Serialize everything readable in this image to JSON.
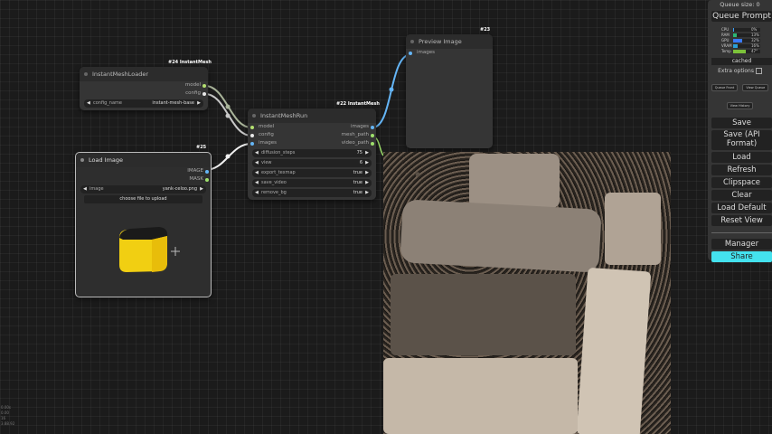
{
  "queue": {
    "size_text": "Queue size: 0",
    "prompt_label": "Queue Prompt"
  },
  "monitor": {
    "rows": [
      {
        "name": "CPU",
        "value": "0%",
        "level": 0.0,
        "color": "#3aa0ff"
      },
      {
        "name": "RAM",
        "value": "13%",
        "level": 0.13,
        "color": "#2bb673"
      },
      {
        "name": "GPU",
        "value": "32%",
        "level": 0.32,
        "color": "#3a7bff"
      },
      {
        "name": "VRAM",
        "value": "16%",
        "level": 0.16,
        "color": "#2a9fd8"
      },
      {
        "name": "Temp",
        "value": "47°",
        "level": 0.47,
        "color": "#7cc23a"
      }
    ],
    "cached_text": "cached"
  },
  "menu": {
    "extra_options": "Extra options",
    "queue_front": "Queue Front",
    "view_queue": "View Queue",
    "view_history": "View History",
    "save": "Save",
    "save_api": "Save (API Format)",
    "load": "Load",
    "refresh": "Refresh",
    "clipspace": "Clipspace",
    "clear": "Clear",
    "load_default": "Load Default",
    "reset_view": "Reset View",
    "manager": "Manager",
    "share": "Share"
  },
  "nodes": {
    "loader": {
      "badge": "#24 InstantMesh",
      "title": "InstantMeshLoader",
      "outputs": [
        "model",
        "config"
      ],
      "widget_label": "config_name",
      "widget_value": "instant-mesh-base"
    },
    "run": {
      "badge": "#22 InstantMesh",
      "title": "InstantMeshRun",
      "inputs": [
        "model",
        "config",
        "images"
      ],
      "outputs": [
        "images",
        "mesh_path",
        "video_path"
      ],
      "widgets": [
        {
          "label": "diffusion_steps",
          "value": "75"
        },
        {
          "label": "view",
          "value": "6"
        },
        {
          "label": "export_texmap",
          "value": "true"
        },
        {
          "label": "save_video",
          "value": "true"
        },
        {
          "label": "remove_bg",
          "value": "true"
        }
      ]
    },
    "load_image": {
      "badge": "#25",
      "title": "Load Image",
      "outputs": [
        "IMAGE",
        "MASK"
      ],
      "widget_label": "image",
      "widget_value": "yank-celoo.png",
      "upload_label": "choose file to upload"
    },
    "preview": {
      "badge": "#23",
      "title": "Preview Image",
      "inputs": [
        "images"
      ]
    }
  },
  "colors": {
    "model_slot": "#b4e070",
    "config_slot": "#e8e8e8",
    "image_slot": "#64b5f6",
    "string_slot": "#9ee06c",
    "link_image": "#64b5f6",
    "link_model": "#a9b49a"
  },
  "footer": {
    "lines": [
      "0.00s",
      "0.00",
      "16",
      "3.88.92"
    ]
  }
}
